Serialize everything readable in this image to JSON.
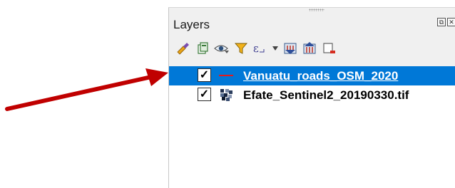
{
  "panel": {
    "title": "Layers",
    "window_buttons": {
      "float_glyph": "⧉",
      "close_glyph": "✕"
    }
  },
  "toolbar": {
    "icons": [
      "style-manager-icon",
      "add-group-icon",
      "visibility-eye-icon",
      "filter-icon",
      "expression-filter-icon",
      "expand-all-icon",
      "collapse-all-icon",
      "remove-layer-icon"
    ],
    "expression_glyph": "ε"
  },
  "layers": [
    {
      "name": "Vanuatu_roads_OSM_2020",
      "checked": "✓",
      "selected": true,
      "symbol_color": "#e31a1c"
    },
    {
      "name": "Efate_Sentinel2_20190330.tif",
      "checked": "✓",
      "selected": false
    }
  ],
  "annotation": {
    "arrow_color": "#c00000"
  },
  "colors": {
    "selection": "#0078d7",
    "panel_header": "#f0f0f0"
  }
}
